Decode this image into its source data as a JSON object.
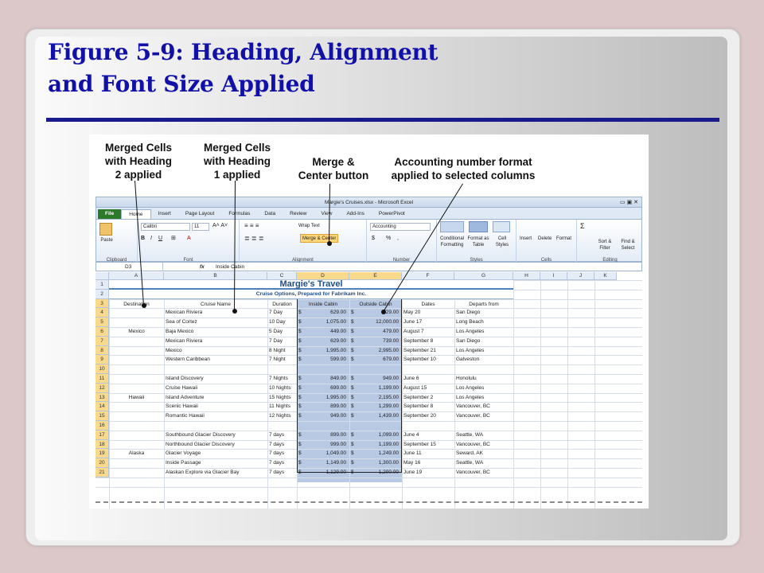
{
  "slide": {
    "title_line1": "Figure 5-9: Heading, Alignment",
    "title_line2": "and Font Size Applied"
  },
  "callouts": {
    "c1": [
      "Merged Cells",
      "with Heading",
      "2 applied"
    ],
    "c2": [
      "Merged Cells",
      "with Heading",
      "1 applied"
    ],
    "c3": [
      "Merge &",
      "Center button"
    ],
    "c4": [
      "Accounting number format",
      "applied to selected columns"
    ]
  },
  "excel": {
    "window_title": "Margie's Cruises.xlsx - Microsoft Excel",
    "tabs": [
      "File",
      "Home",
      "Insert",
      "Page Layout",
      "Formulas",
      "Data",
      "Review",
      "View",
      "Add-Ins",
      "PowerPivot"
    ],
    "ribbon": {
      "font_name": "Calibri",
      "font_size": "11",
      "wrap_text": "Wrap Text",
      "merge_center": "Merge & Center",
      "number_format": "Accounting",
      "groups": [
        "Clipboard",
        "Font",
        "Alignment",
        "Number",
        "Styles",
        "Cells",
        "Editing"
      ],
      "paste": "Paste",
      "cond_format": "Conditional Formatting",
      "format_table": "Format as Table",
      "cell_styles": "Cell Styles",
      "insert": "Insert",
      "delete": "Delete",
      "format": "Format",
      "sort_filter": "Sort & Filter",
      "find_select": "Find & Select",
      "dollar": "$",
      "percent": "%",
      "comma": ","
    },
    "name_box": "D3",
    "fx": "fx",
    "formula": "Inside Cabin",
    "columns": [
      "A",
      "B",
      "C",
      "D",
      "E",
      "F",
      "G",
      "H",
      "I",
      "J",
      "K"
    ],
    "rows": [
      "1",
      "2",
      "3",
      "4",
      "5",
      "6",
      "7",
      "8",
      "9",
      "10",
      "11",
      "12",
      "13",
      "14",
      "15",
      "16",
      "17",
      "18",
      "19",
      "20",
      "21"
    ],
    "heading1": "Margie's Travel",
    "heading2": "Cruise Options, Prepared for Fabrikam Inc.",
    "headers": [
      "Destination",
      "Cruise Name",
      "Duration",
      "Inside Cabin",
      "Outside Cabin",
      "Dates",
      "Departs from"
    ],
    "groups": [
      {
        "name": "Mexico",
        "row": 6
      },
      {
        "name": "Hawaii",
        "row": 13
      },
      {
        "name": "Alaska",
        "row": 19
      }
    ],
    "data": [
      {
        "row": 4,
        "name": "Mexican Riviera",
        "dur": "7 Day",
        "in": "629.00",
        "out": "729.00",
        "date": "May 20",
        "from": "San Diego"
      },
      {
        "row": 5,
        "name": "Sea of Cortez",
        "dur": "10 Day",
        "in": "1,075.00",
        "out": "12,000.00",
        "date": "June 17",
        "from": "Long Beach"
      },
      {
        "row": 6,
        "name": "Baja Mexico",
        "dur": "5 Day",
        "in": "449.00",
        "out": "479.00",
        "date": "August 7",
        "from": "Los Angeles"
      },
      {
        "row": 7,
        "name": "Mexican Riviera",
        "dur": "7 Day",
        "in": "629.00",
        "out": "739.00",
        "date": "September 8",
        "from": "San Diego"
      },
      {
        "row": 8,
        "name": "Mexico",
        "dur": "8 Night",
        "in": "1,995.00",
        "out": "2,995.00",
        "date": "September 21",
        "from": "Los Angeles"
      },
      {
        "row": 9,
        "name": "Western Caribbean",
        "dur": "7 Night",
        "in": "599.00",
        "out": "679.00",
        "date": "September 10",
        "from": "Galveston"
      },
      {
        "row": 11,
        "name": "Island Discovery",
        "dur": "7 Nights",
        "in": "849.00",
        "out": "949.00",
        "date": "June 6",
        "from": "Honolulu"
      },
      {
        "row": 12,
        "name": "Cruise Hawaii",
        "dur": "10 Nights",
        "in": "699.00",
        "out": "1,199.00",
        "date": "August 15",
        "from": "Los Angeles"
      },
      {
        "row": 13,
        "name": "Island Adventure",
        "dur": "15 Nights",
        "in": "1,995.00",
        "out": "2,195.00",
        "date": "September 2",
        "from": "Los Angeles"
      },
      {
        "row": 14,
        "name": "Scenic Hawaii",
        "dur": "11 Nights",
        "in": "899.00",
        "out": "1,299.00",
        "date": "September 8",
        "from": "Vancouver, BC"
      },
      {
        "row": 15,
        "name": "Romantic Hawaii",
        "dur": "12 Nights",
        "in": "949.00",
        "out": "1,439.00",
        "date": "September 20",
        "from": "Vancouver, BC"
      },
      {
        "row": 17,
        "name": "Southbound Glacier Discovery",
        "dur": "7 days",
        "in": "899.00",
        "out": "1,099.00",
        "date": "June 4",
        "from": "Seattle, WA"
      },
      {
        "row": 18,
        "name": "Northbound Glacier Discovery",
        "dur": "7 days",
        "in": "999.00",
        "out": "1,199.00",
        "date": "September 15",
        "from": "Vancouver, BC"
      },
      {
        "row": 19,
        "name": "Glacier Voyage",
        "dur": "7 days",
        "in": "1,049.00",
        "out": "1,249.00",
        "date": "June 11",
        "from": "Seward, AK"
      },
      {
        "row": 20,
        "name": "Inside Passage",
        "dur": "7 days",
        "in": "1,149.00",
        "out": "1,300.00",
        "date": "May 16",
        "from": "Seattle, WA"
      },
      {
        "row": 21,
        "name": "Alaskan Explore via Glacier Bay",
        "dur": "7 days",
        "in": "1,129.00",
        "out": "1,200.00",
        "date": "June 19",
        "from": "Vancouver, BC"
      }
    ],
    "currency": "$"
  }
}
